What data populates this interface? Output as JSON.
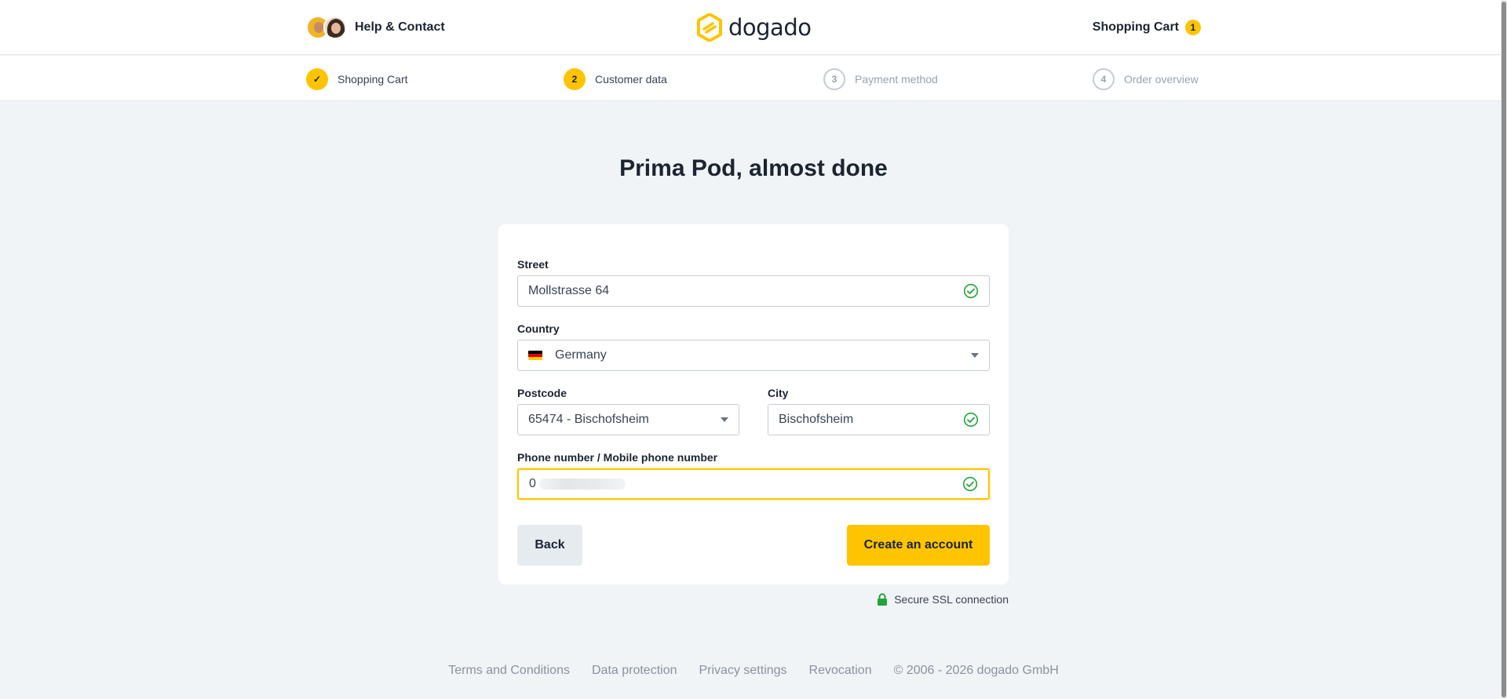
{
  "header": {
    "help_label": "Help & Contact",
    "logo_text": "dogado",
    "cart_label": "Shopping Cart",
    "cart_count": "1"
  },
  "stepper": [
    {
      "number": "✓",
      "label": "Shopping Cart",
      "state": "done"
    },
    {
      "number": "2",
      "label": "Customer data",
      "state": "active"
    },
    {
      "number": "3",
      "label": "Payment method",
      "state": "todo"
    },
    {
      "number": "4",
      "label": "Order overview",
      "state": "todo"
    }
  ],
  "main": {
    "title": "Prima Pod, almost done"
  },
  "form": {
    "street": {
      "label": "Street",
      "value": "Mollstrasse 64"
    },
    "country": {
      "label": "Country",
      "value": "Germany"
    },
    "postcode": {
      "label": "Postcode",
      "value": "65474 - Bischofsheim"
    },
    "city": {
      "label": "City",
      "value": "Bischofsheim"
    },
    "phone": {
      "label": "Phone number / Mobile phone number",
      "value": "0"
    }
  },
  "actions": {
    "back_label": "Back",
    "create_label": "Create an account"
  },
  "ssl_label": "Secure SSL connection",
  "footer": {
    "terms": "Terms and Conditions",
    "data_protection": "Data protection",
    "privacy_settings": "Privacy settings",
    "revocation": "Revocation",
    "copyright": "© 2006 - 2026 dogado GmbH"
  },
  "colors": {
    "accent": "#fec400",
    "background": "#f1f4f7",
    "text": "#1c2331",
    "success": "#22a33a"
  },
  "icons": [
    "check-icon",
    "lock-icon",
    "chevron-down-icon",
    "germany-flag-icon",
    "dogado-logo-icon"
  ]
}
